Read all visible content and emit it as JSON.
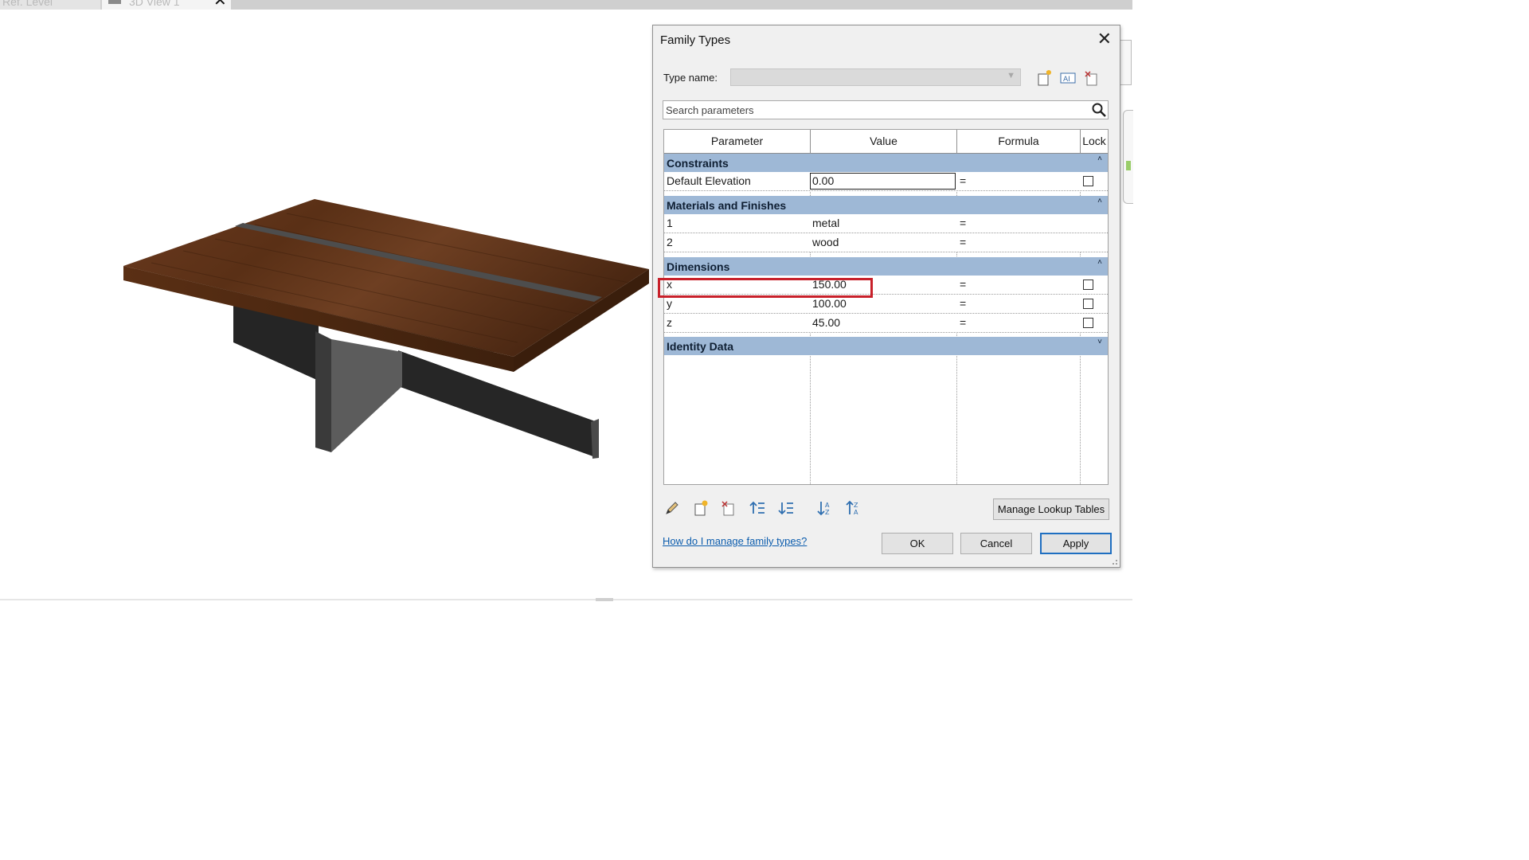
{
  "tabs": [
    {
      "label": "Ref. Level"
    },
    {
      "label": "3D View 1",
      "close": "✕"
    }
  ],
  "dialog": {
    "title": "Family Types",
    "close": "✕",
    "type_name_label": "Type name:",
    "type_name_value": "",
    "search": {
      "placeholder": "Search parameters"
    },
    "columns": [
      "Parameter",
      "Value",
      "Formula",
      "Lock"
    ],
    "groups": {
      "constraints": {
        "label": "Constraints",
        "rows": [
          {
            "name": "Default Elevation",
            "value": "0.00",
            "formula": "=",
            "lock": false
          }
        ]
      },
      "materials": {
        "label": "Materials and Finishes",
        "rows": [
          {
            "name": "1",
            "value": "metal",
            "formula": "="
          },
          {
            "name": "2",
            "value": "wood",
            "formula": "="
          }
        ]
      },
      "dimensions": {
        "label": "Dimensions",
        "rows": [
          {
            "name": "x",
            "value": "150.00",
            "formula": "=",
            "lock": false
          },
          {
            "name": "y",
            "value": "100.00",
            "formula": "=",
            "lock": false
          },
          {
            "name": "z",
            "value": "45.00",
            "formula": "=",
            "lock": false
          }
        ]
      },
      "identity": {
        "label": "Identity Data"
      }
    },
    "buttons": {
      "manage_lookup": "Manage Lookup Tables",
      "ok": "OK",
      "cancel": "Cancel",
      "apply": "Apply"
    },
    "help_link": "How do I manage family types?"
  },
  "colors": {
    "group_header": "#9eb8d6",
    "highlight": "#c8202a",
    "link": "#0b5cad",
    "apply_border": "#1f6fc1"
  }
}
